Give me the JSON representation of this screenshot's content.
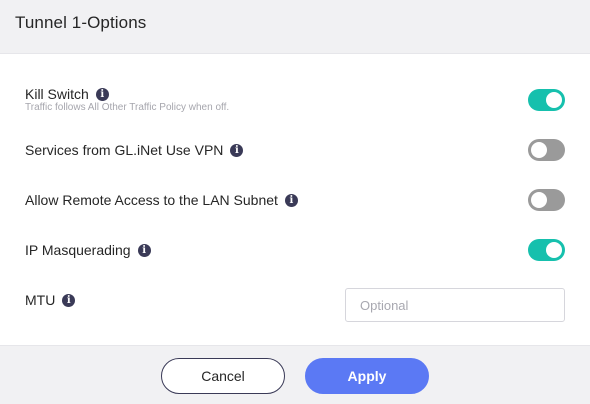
{
  "header": {
    "title": "Tunnel 1-Options"
  },
  "options": [
    {
      "label": "Kill Switch",
      "subtext": "Traffic follows All Other Traffic Policy when off.",
      "state": "on"
    },
    {
      "label": "Services from GL.iNet Use VPN",
      "state": "off"
    },
    {
      "label": "Allow Remote Access to the LAN Subnet",
      "state": "off"
    },
    {
      "label": "IP Masquerading",
      "state": "on"
    }
  ],
  "mtu": {
    "label": "MTU",
    "value": "",
    "placeholder": "Optional"
  },
  "info_icon": {
    "name": "info-icon",
    "glyph": "i"
  },
  "footer": {
    "cancel_label": "Cancel",
    "apply_label": "Apply"
  },
  "colors": {
    "toggle_on": "#16c0ad",
    "toggle_off": "#9a9a9a",
    "apply_button": "#5b79f4",
    "info_icon": "#3a3a57"
  }
}
